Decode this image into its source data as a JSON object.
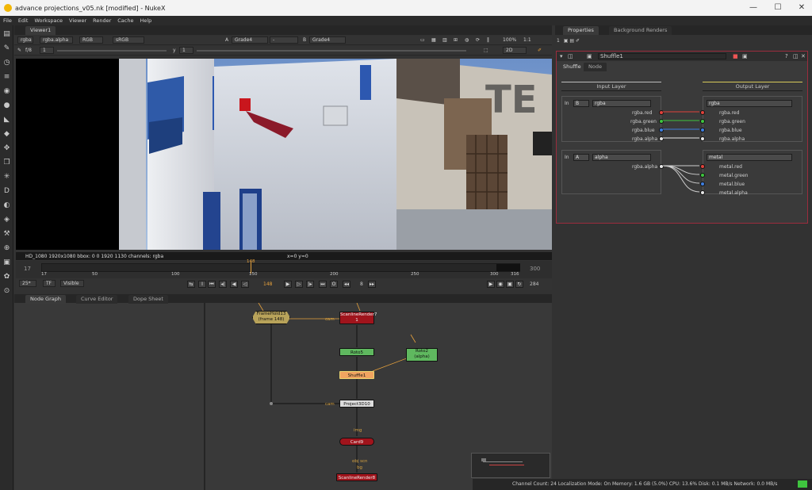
{
  "window": {
    "title": "advance projections_v05.nk [modified] - NukeX",
    "minimize": "—",
    "maximize": "☐",
    "close": "✕"
  },
  "menu": [
    "File",
    "Edit",
    "Workspace",
    "Viewer",
    "Render",
    "Cache",
    "Help"
  ],
  "viewer": {
    "tab": "Viewer1",
    "channels": "rgba",
    "alpha": "rgba.alpha",
    "colorspace": "RGB",
    "lut": "sRGB",
    "input_a_label": "A",
    "input_a": "Grade4",
    "input_a_op": "-",
    "input_b_label": "B",
    "input_b": "Grade4",
    "zoom": "100%",
    "ratio": "1:1",
    "fstop": "f/8",
    "frame_box": "1",
    "gamma_label": "y",
    "gamma": "1",
    "view_mode": "2D",
    "status_left": "HD_1080 1920x1080  bbox: 0 0 1920 1130 channels: rgba",
    "status_coords": "x=0 y=0",
    "watermark_text": "TE",
    "timeline": {
      "start": "17",
      "end": "300",
      "current": "148",
      "ticks": [
        "17",
        "50",
        "100",
        "150",
        "200",
        "250",
        "300",
        "316"
      ],
      "fps": "25*",
      "tf": "TF",
      "visible": "Visible",
      "frame_field": "148",
      "step": "8",
      "end_field": "284"
    }
  },
  "nodegraph": {
    "tabs": [
      "Node Graph",
      "Curve Editor",
      "Dope Sheet"
    ],
    "nodes": {
      "framehold": "FrameHold13\n(frame 148)",
      "scanline7": "ScanlineRender7",
      "scanline7_sub": "1",
      "roto1": "Roto5",
      "roto2": "Roto2\n(alpha)",
      "shuffle": "Shuffle1",
      "project": "Project3D10",
      "card": "Card9",
      "scanline8": "ScanlineRender8"
    },
    "labels": {
      "cam1": "cam",
      "cam2": "cam",
      "img": "img",
      "bg": "bg",
      "obj_scn": "obj scn",
      "bg2": "bg"
    }
  },
  "properties": {
    "tabs": [
      "Properties",
      "Background Renders"
    ],
    "node_name": "Shuffle1",
    "subtabs": [
      "Shuffle",
      "Node"
    ],
    "input_layer": "Input Layer",
    "output_layer": "Output Layer",
    "in_label": "In",
    "in1_sel": "B",
    "in1_layer": "rgba",
    "in1_channels": [
      "rgba.red",
      "rgba.green",
      "rgba.blue",
      "rgba.alpha"
    ],
    "out1_layer": "rgba",
    "out1_channels": [
      "rgba.red",
      "rgba.green",
      "rgba.blue",
      "rgba.alpha"
    ],
    "in2_sel": "A",
    "in2_layer": "alpha",
    "in2_channels": [
      "rgba.alpha"
    ],
    "out2_layer": "metal",
    "out2_channels": [
      "metal.red",
      "metal.green",
      "metal.blue",
      "metal.alpha"
    ]
  },
  "statusbar": "Channel Count: 24  Localization Mode: On  Memory: 1.6 GB (5.0%)  CPU: 13.6%  Disk: 0.1 MB/s  Network: 0.0 MB/s",
  "colors": {
    "red": "#e0423b",
    "green": "#3fc43f",
    "blue": "#3f7fe0",
    "white": "#e6e6e6",
    "scanline": "#a0141c",
    "framehold": "#b8a35a",
    "roto": "#5fb85f",
    "shuffle": "#f0a460"
  }
}
